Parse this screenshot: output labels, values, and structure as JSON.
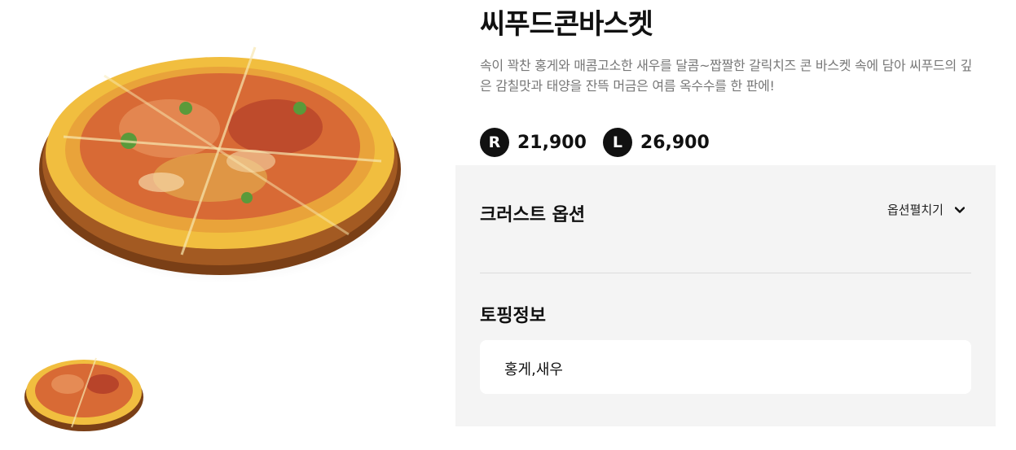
{
  "product": {
    "title": "씨푸드콘바스켓",
    "description": "속이 꽉찬 홍게와 매콤고소한 새우를 달콤~짭짤한 갈릭치즈 콘 바스켓 속에 담아 씨푸드의 깊은 감칠맛과 태양을 잔뜩 머금은 여름 옥수수를 한 판에!"
  },
  "prices": [
    {
      "size": "R",
      "price": "21,900"
    },
    {
      "size": "L",
      "price": "26,900"
    }
  ],
  "crust": {
    "title": "크러스트 옵션",
    "expand_label": "옵션펼치기"
  },
  "topping": {
    "title": "토핑정보",
    "value": "홍게,새우"
  },
  "colors": {
    "panel_bg": "#f4f4f4",
    "badge_bg": "#111111",
    "desc_text": "#777777"
  }
}
